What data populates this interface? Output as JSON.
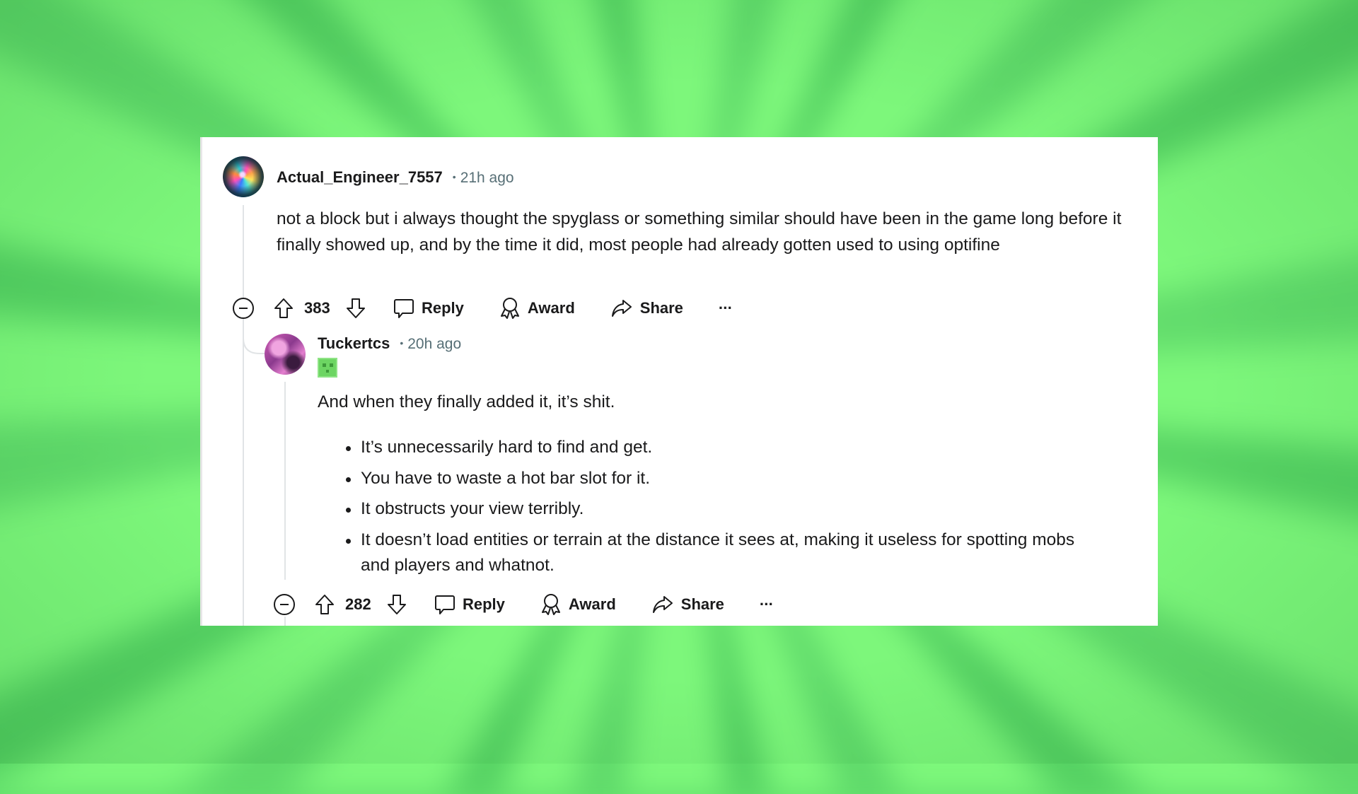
{
  "background": {
    "accent": "#7df77b",
    "ray_dark": "#54d062"
  },
  "comments": [
    {
      "username": "Actual_Engineer_7557",
      "separator": "•",
      "time": "21h ago",
      "body": "not a block but i always thought the spyglass or something similar should have been in the game long before it finally showed up, and by the time it did, most people had already gotten used to using optifine",
      "actions": {
        "collapse_icon": "minus-circle-icon",
        "upvote_icon": "arrow-up-outline-icon",
        "score": "383",
        "downvote_icon": "arrow-down-outline-icon",
        "reply": "Reply",
        "award": "Award",
        "share": "Share",
        "more": "···"
      }
    },
    {
      "username": "Tuckertcs",
      "separator": "•",
      "time": "20h ago",
      "flair_icon": "slime-face-flair-icon",
      "intro": "And when they finally added it, it’s shit.",
      "bullets": [
        "It’s unnecessarily hard to find and get.",
        "You have to waste a hot bar slot for it.",
        "It obstructs your view terribly.",
        "It doesn’t load entities or terrain at the distance it sees at, making it useless for spotting mobs and players and whatnot."
      ],
      "actions": {
        "collapse_icon": "minus-circle-icon",
        "upvote_icon": "arrow-up-outline-icon",
        "score": "282",
        "downvote_icon": "arrow-down-outline-icon",
        "reply": "Reply",
        "award": "Award",
        "share": "Share",
        "more": "···"
      }
    }
  ]
}
